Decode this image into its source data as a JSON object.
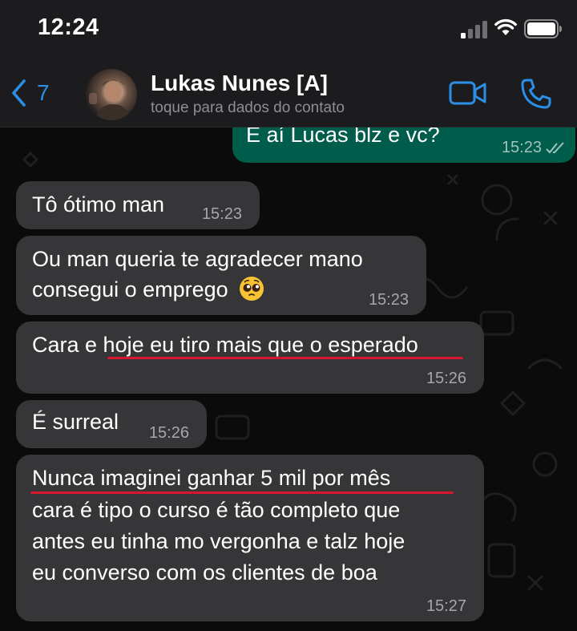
{
  "status_bar": {
    "time": "12:24"
  },
  "header": {
    "back_count": "7",
    "contact_name": "Lukas Nunes [A]",
    "contact_subtitle": "toque para dados do contato"
  },
  "messages": [
    {
      "direction": "outgoing",
      "text": "E aí Lucas blz e vc?",
      "time": "15:23",
      "status": "read"
    },
    {
      "direction": "incoming",
      "text": "Tô ótimo man",
      "time": "15:23"
    },
    {
      "direction": "incoming",
      "line1": "Ou man queria te agradecer mano",
      "line2": "consegui o emprego",
      "emoji": "pleading-face-emoji",
      "time": "15:23"
    },
    {
      "direction": "incoming",
      "prefix": "Cara e ",
      "highlight": "hoje eu tiro mais que o esperado",
      "time": "15:26"
    },
    {
      "direction": "incoming",
      "text": "É surreal",
      "time": "15:26"
    },
    {
      "direction": "incoming",
      "highlight": "Nunca imaginei ganhar 5 mil por mês",
      "line2": "cara é tipo o curso é tão completo que",
      "line3": "antes eu tinha mo vergonha e talz hoje",
      "line4": "eu converso com os clientes de boa",
      "time": "15:27"
    }
  ],
  "colors": {
    "accent": "#2b8fe8",
    "outgoing_bubble": "#005c4b",
    "incoming_bubble": "#363638",
    "highlight_underline": "#d6152f"
  }
}
